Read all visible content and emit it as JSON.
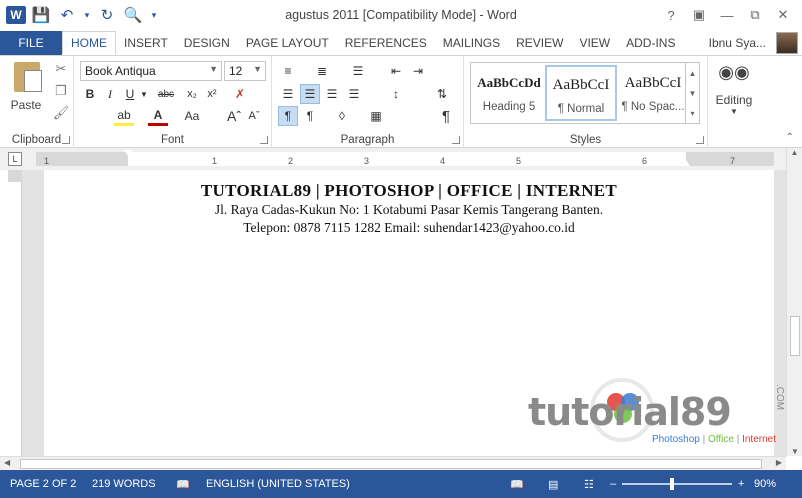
{
  "window": {
    "title": "agustus 2011 [Compatibility Mode] - Word",
    "user": "Ibnu Sya...",
    "word_icon": "W"
  },
  "qat": {
    "icons": [
      "save-icon",
      "undo-icon",
      "redo-icon",
      "print-preview-icon",
      "customize-icon"
    ]
  },
  "tabs": [
    {
      "label": "FILE"
    },
    {
      "label": "HOME"
    },
    {
      "label": "INSERT"
    },
    {
      "label": "DESIGN"
    },
    {
      "label": "PAGE LAYOUT"
    },
    {
      "label": "REFERENCES"
    },
    {
      "label": "MAILINGS"
    },
    {
      "label": "REVIEW"
    },
    {
      "label": "VIEW"
    },
    {
      "label": "ADD-INS"
    }
  ],
  "ribbon": {
    "clipboard": {
      "label": "Clipboard",
      "paste": "Paste"
    },
    "font": {
      "label": "Font",
      "name": "Book Antiqua",
      "size": "12"
    },
    "paragraph": {
      "label": "Paragraph"
    },
    "styles": {
      "label": "Styles",
      "items": [
        {
          "sample": "AaBbCcDd",
          "name": "Heading 5"
        },
        {
          "sample": "AaBbCcI",
          "name": "¶ Normal"
        },
        {
          "sample": "AaBbCcI",
          "name": "¶ No Spac..."
        }
      ]
    },
    "editing": {
      "label": "Editing"
    }
  },
  "ruler": {
    "numbers": [
      "1",
      "1",
      "2",
      "3",
      "4",
      "5",
      "6",
      "7"
    ]
  },
  "document": {
    "line1": "TUTORIAL89 | PHOTOSHOP | OFFICE | INTERNET",
    "line2": "Jl. Raya Cadas-Kukun No: 1 Kotabumi Pasar Kemis Tangerang Banten.",
    "line3": "Telepon: 0878 7115 1282 Email: suhendar1423@yahoo.co.id"
  },
  "watermark": {
    "main": "tutorial89",
    "com": ".COM",
    "sub1": "Photoshop",
    "sub2": "Office",
    "sub3": "Internet",
    "sep": " | "
  },
  "status": {
    "page": "PAGE 2 OF 2",
    "words": "219 WORDS",
    "language": "ENGLISH (UNITED STATES)",
    "zoom": "90%"
  },
  "colors": {
    "accent": "#2b579a",
    "logo_gray": "#8a8a8a",
    "logo_blue": "#3a7bd5",
    "logo_red": "#e03a2f",
    "logo_green": "#6cbf3e"
  }
}
